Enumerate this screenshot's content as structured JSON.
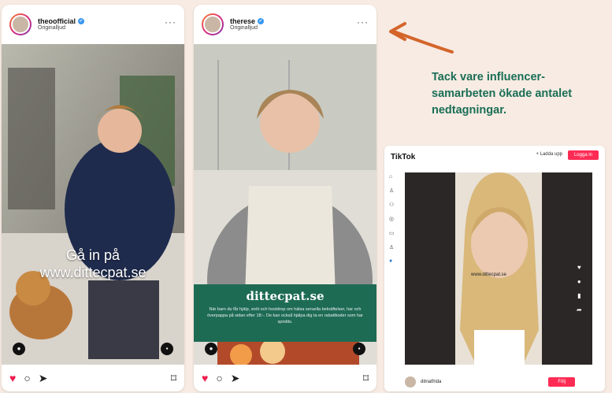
{
  "callout": {
    "text": "Tack vare influencer-samarbeten ökade antalet nedtagningar."
  },
  "post1": {
    "username": "theoofficial",
    "subtitle": "Originalljud",
    "overlay_line1": "Gå in på",
    "overlay_line2": "www.dittecpat.se"
  },
  "post2": {
    "username": "therese",
    "subtitle": "Originalljud",
    "banner_title": "dittecpat.se",
    "banner_body": "När barn du får hjälp, snöt och hostdrop om hälsa seruella bekräftelser, har och överpappa på sidan efter 18:-. De kan också hjälpa dig ta en rabattkoder som har spridits."
  },
  "tiktok": {
    "logo": "TikTok",
    "upload_label": "+ Ladda upp",
    "login_label": "Logga in",
    "caption": "www.dittecpat.se",
    "username": "ditnatfrida",
    "follow_label": "Följ"
  },
  "colors": {
    "accent": "#1a6e56",
    "heart": "#ed1c4d",
    "tiktok_red": "#fe2c55",
    "banner": "#1e6b54"
  },
  "icons": [
    "heart-icon",
    "comment-icon",
    "share-icon",
    "bookmark-icon",
    "more-icon",
    "verified-icon"
  ]
}
